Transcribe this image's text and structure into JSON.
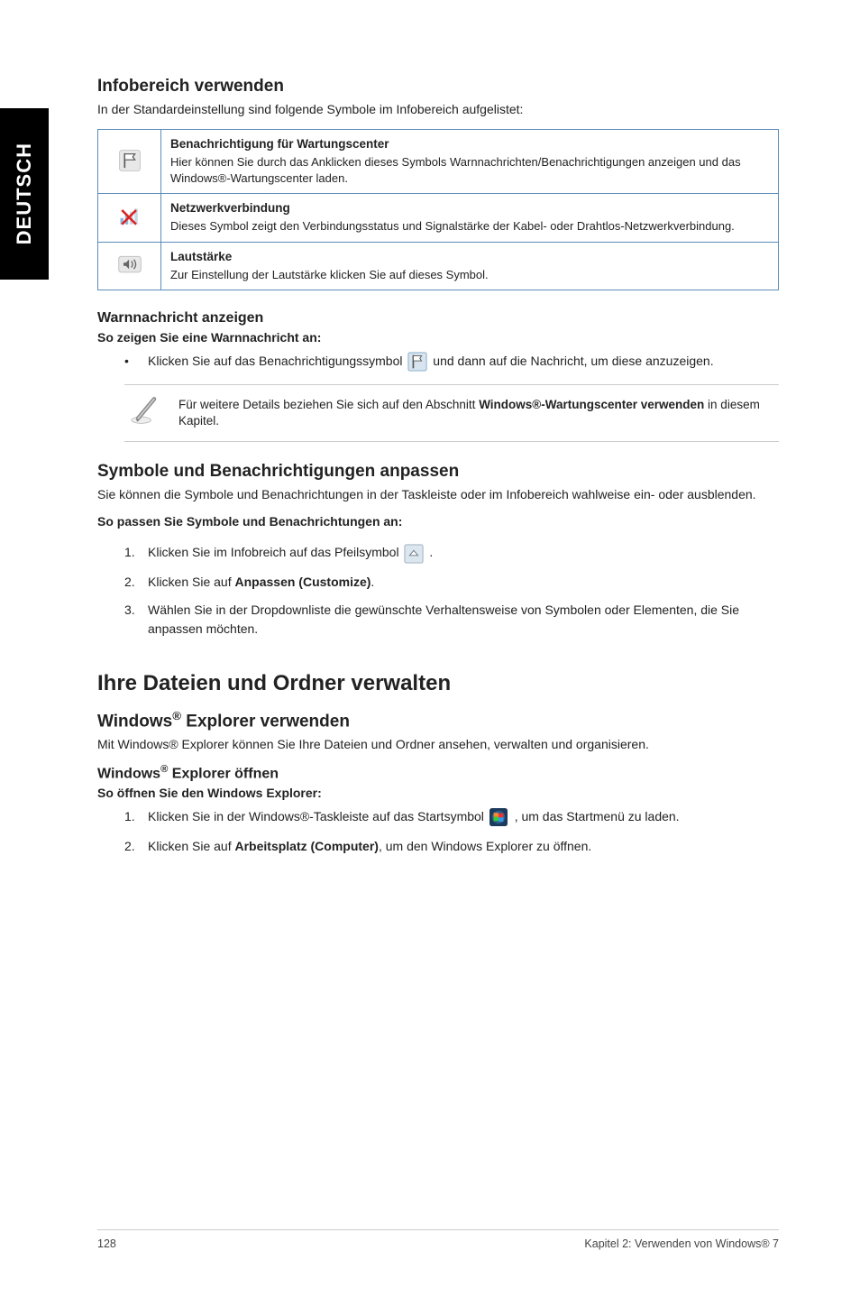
{
  "side_tab": "DEUTSCH",
  "s1": {
    "heading": "Infobereich verwenden",
    "intro": "In der Standardeinstellung sind folgende Symbole im Infobereich aufgelistet:",
    "rows": [
      {
        "title": "Benachrichtigung für Wartungscenter",
        "desc": "Hier können Sie durch das Anklicken dieses Symbols Warnnachrichten/Benachrichtigungen anzeigen und das Windows®-Wartungscenter laden."
      },
      {
        "title": "Netzwerkverbindung",
        "desc": "Dieses Symbol zeigt den Verbindungsstatus und Signalstärke der Kabel- oder Drahtlos-Netzwerkverbindung."
      },
      {
        "title": "Lautstärke",
        "desc": "Zur Einstellung der Lautstärke klicken Sie auf dieses Symbol."
      }
    ]
  },
  "s2": {
    "heading": "Warnnachricht anzeigen",
    "bold": "So zeigen Sie eine Warnnachricht an:",
    "bullet_a": "Klicken Sie auf das Benachrichtigungssymbol ",
    "bullet_b": " und dann auf die Nachricht, um diese anzuzeigen.",
    "note_a": "Für weitere Details beziehen Sie sich auf den Abschnitt ",
    "note_bold": "Windows®-Wartungscenter verwenden",
    "note_b": " in diesem Kapitel."
  },
  "s3": {
    "heading": "Symbole und Benachrichtigungen anpassen",
    "intro": "Sie können die Symbole und Benachrichtungen in der Taskleiste oder im Infobereich wahlweise ein- oder ausblenden.",
    "bold": "So passen Sie Symbole und Benachrichtungen an:",
    "step1_a": "Klicken Sie im Infobreich auf das Pfeilsymbol ",
    "step1_b": ".",
    "step2_a": "Klicken Sie auf ",
    "step2_bold": "Anpassen (Customize)",
    "step2_b": ".",
    "step3": "Wählen Sie in der Dropdownliste die gewünschte Verhaltensweise von Symbolen oder Elementen, die Sie anpassen möchten."
  },
  "s4": {
    "big": "Ihre Dateien und Ordner verwalten",
    "heading": "Windows® Explorer verwenden",
    "intro": "Mit Windows® Explorer können Sie Ihre Dateien und Ordner ansehen, verwalten und organisieren.",
    "sub": "Windows® Explorer öffnen",
    "bold": "So öffnen Sie den Windows Explorer:",
    "step1_a": "Klicken Sie in der Windows®-Taskleiste auf das Startsymbol ",
    "step1_b": ", um das Startmenü zu laden.",
    "step2_a": "Klicken Sie auf ",
    "step2_bold": "Arbeitsplatz (Computer)",
    "step2_b": ", um den Windows Explorer zu öffnen."
  },
  "footer": {
    "page": "128",
    "chapter": "Kapitel 2: Verwenden von Windows® 7"
  },
  "nums": {
    "n1": "1.",
    "n2": "2.",
    "n3": "3."
  }
}
